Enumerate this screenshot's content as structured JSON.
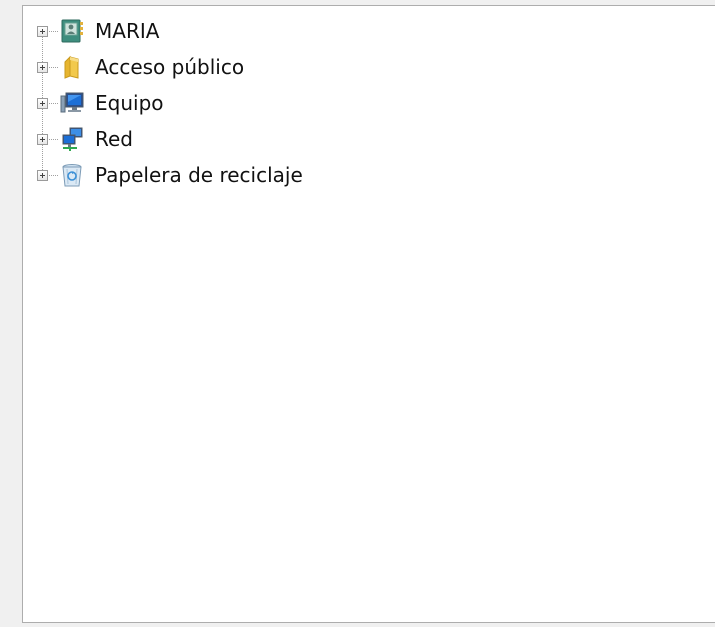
{
  "tree": {
    "items": [
      {
        "label": "MARIA",
        "icon": "user-folder-icon"
      },
      {
        "label": "Acceso público",
        "icon": "folder-icon"
      },
      {
        "label": "Equipo",
        "icon": "computer-icon"
      },
      {
        "label": "Red",
        "icon": "network-icon"
      },
      {
        "label": "Papelera de reciclaje",
        "icon": "recycle-bin-icon"
      }
    ]
  }
}
